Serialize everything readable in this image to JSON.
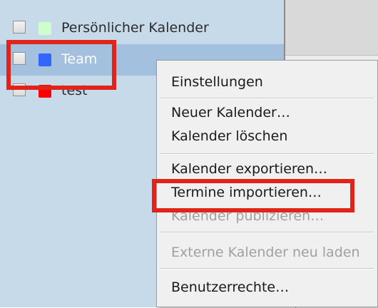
{
  "calendars": [
    {
      "label": "Persönlicher Kalender",
      "color": "#ccffcc",
      "selected": false
    },
    {
      "label": "Team",
      "color": "#3366ff",
      "selected": true
    },
    {
      "label": "test",
      "color": "#ff0000",
      "selected": false
    }
  ],
  "context_menu": {
    "items": [
      {
        "label": "Einstellungen",
        "enabled": true
      },
      {
        "label": "Neuer Kalender…",
        "enabled": true
      },
      {
        "label": "Kalender löschen",
        "enabled": true
      },
      {
        "label": "Kalender exportieren…",
        "enabled": true
      },
      {
        "label": "Termine importieren…",
        "enabled": true,
        "highlighted": true
      },
      {
        "label": "Kalender publizieren…",
        "enabled": false
      },
      {
        "label": "Externe Kalender neu laden",
        "enabled": false
      },
      {
        "label": "Benutzerrechte…",
        "enabled": true
      }
    ]
  },
  "highlight_color": "#e2231a"
}
